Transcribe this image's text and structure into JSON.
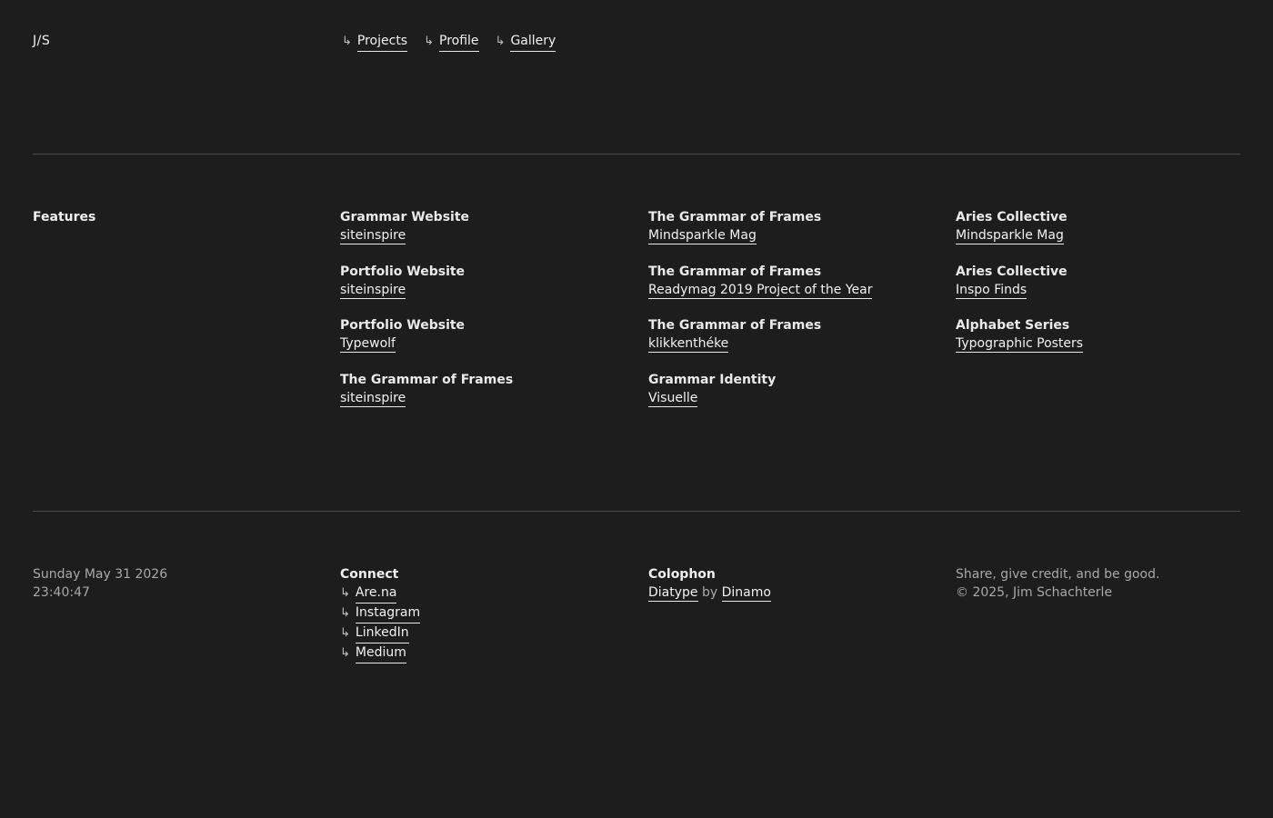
{
  "header": {
    "logo": "J/S",
    "arrow": "↳",
    "nav": [
      "Projects",
      "Profile",
      "Gallery"
    ]
  },
  "features": {
    "label": "Features",
    "columns": [
      [
        {
          "title": "Grammar Website",
          "source": "siteinspire"
        },
        {
          "title": "Portfolio Website",
          "source": "siteinspire"
        },
        {
          "title": "Portfolio Website",
          "source": "Typewolf"
        },
        {
          "title": "The Grammar of Frames",
          "source": "siteinspire"
        }
      ],
      [
        {
          "title": "The Grammar of Frames",
          "source": "Mindsparkle Mag"
        },
        {
          "title": "The Grammar of Frames",
          "source": "Readymag 2019 Project of the Year"
        },
        {
          "title": "The Grammar of Frames",
          "source": "klikkenthéke"
        },
        {
          "title": "Grammar Identity",
          "source": "Visuelle"
        }
      ],
      [
        {
          "title": "Aries Collective",
          "source": "Mindsparkle Mag"
        },
        {
          "title": "Aries Collective",
          "source": "Inspo Finds"
        },
        {
          "title": "Alphabet Series",
          "source": "Typographic Posters"
        }
      ]
    ]
  },
  "footer": {
    "date": "Sunday May 31 2026",
    "time": "23:40:47",
    "connect": {
      "title": "Connect",
      "links": [
        "Are.na",
        "Instagram",
        "LinkedIn",
        "Medium"
      ]
    },
    "colophon": {
      "title": "Colophon",
      "font": "Diatype",
      "by": "by",
      "foundry": "Dinamo"
    },
    "tagline": "Share, give credit, and be good.",
    "copyright": "© 2025, Jim Schachterle"
  }
}
